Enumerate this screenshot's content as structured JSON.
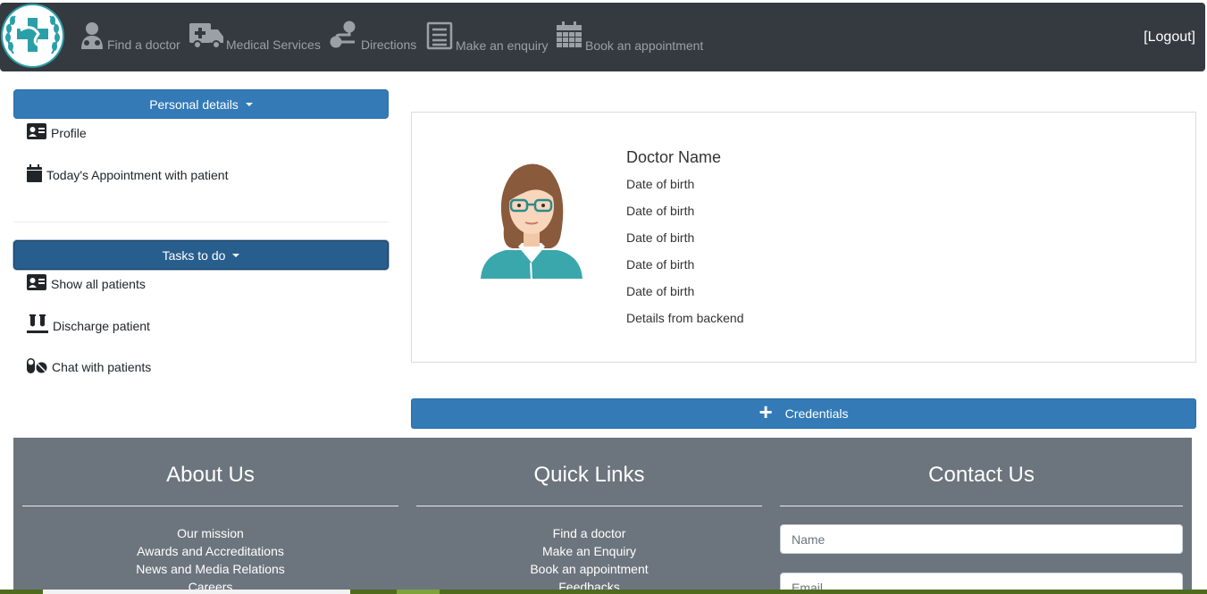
{
  "nav": {
    "items": [
      {
        "label": "Find a doctor",
        "icon": "doctor-icon"
      },
      {
        "label": "Medical Services",
        "icon": "ambulance-icon"
      },
      {
        "label": "Directions",
        "icon": "route-icon"
      },
      {
        "label": "Make an enquiry",
        "icon": "list-icon"
      },
      {
        "label": "Book an appointment",
        "icon": "calendar-grid-icon"
      }
    ],
    "logout": "[Logout]"
  },
  "sidebar": {
    "personal_label": "Personal details",
    "personal_items": [
      {
        "label": "Profile",
        "icon": "id-card-icon"
      },
      {
        "label": "Today's Appointment with patient",
        "icon": "calendar-icon"
      }
    ],
    "tasks_label": "Tasks to do",
    "task_items": [
      {
        "label": "Show all patients",
        "icon": "id-card-icon"
      },
      {
        "label": "Discharge patient",
        "icon": "vials-icon"
      },
      {
        "label": "Chat with patients",
        "icon": "pills-icon"
      }
    ]
  },
  "profile": {
    "name": "Doctor Name",
    "details": [
      "Date of birth",
      "Date of birth",
      "Date of birth",
      "Date of birth",
      "Date of birth",
      "Details from backend"
    ],
    "avatar_icon": "doctor-avatar-icon"
  },
  "credentials_label": "Credentials",
  "footer": {
    "about": {
      "title": "About Us",
      "links": [
        "Our mission",
        "Awards and Accreditations",
        "News and Media Relations",
        "Careers"
      ]
    },
    "quick": {
      "title": "Quick Links",
      "links": [
        "Find a doctor",
        "Make an Enquiry",
        "Book an appointment",
        "Feedbacks"
      ]
    },
    "contact": {
      "title": "Contact Us",
      "name_placeholder": "Name",
      "email_placeholder": "Email"
    }
  },
  "colors": {
    "navbar": "#343a40",
    "primary": "#337ab7",
    "footer": "#6c757d",
    "logo_accent": "#2b9fa8"
  }
}
